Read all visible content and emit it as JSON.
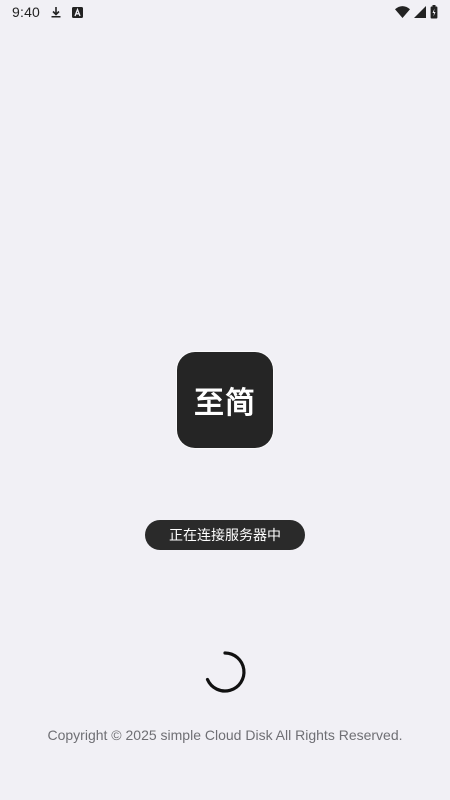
{
  "status_bar": {
    "time": "9:40",
    "left_icons": [
      "download-icon",
      "a-notification-icon"
    ],
    "right_icons": [
      "wifi-icon",
      "signal-icon",
      "battery-icon"
    ]
  },
  "app": {
    "logo_text": "至简"
  },
  "toast": {
    "message": "正在连接服务器中"
  },
  "footer": {
    "copyright": "Copyright © 2025 simple Cloud Disk All Rights Reserved."
  },
  "colors": {
    "background": "#f1f0f5",
    "logo_background": "#252525",
    "toast_background": "#2a2a2a",
    "spinner": "#111111",
    "footer_text": "#6f6f74"
  }
}
